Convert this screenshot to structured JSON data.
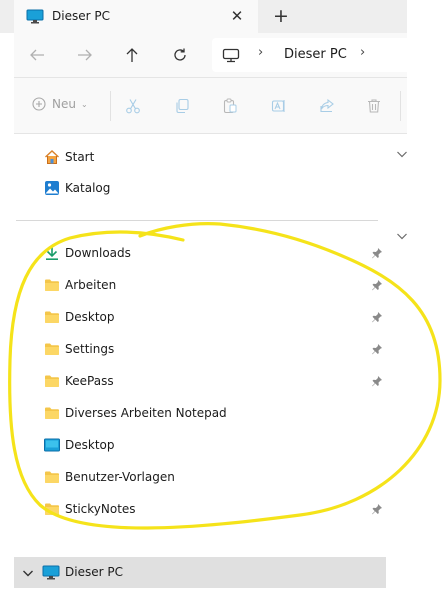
{
  "window": {
    "tab_title": "Dieser PC",
    "close_glyph": "✕",
    "new_tab_glyph": "+"
  },
  "address": {
    "crumbs": [
      "Dieser PC"
    ],
    "separator": "›"
  },
  "toolbar": {
    "new_label": "Neu",
    "new_chevron": "⌄"
  },
  "nav": {
    "top_items": [
      {
        "label": "Start",
        "icon": "home-icon"
      },
      {
        "label": "Katalog",
        "icon": "gallery-icon"
      }
    ],
    "quick_access": [
      {
        "label": "Downloads",
        "icon": "download-icon",
        "pinned": true
      },
      {
        "label": "Arbeiten",
        "icon": "folder-icon",
        "pinned": true
      },
      {
        "label": "Desktop",
        "icon": "folder-icon",
        "pinned": true
      },
      {
        "label": "Settings",
        "icon": "folder-icon",
        "pinned": true
      },
      {
        "label": "KeePass",
        "icon": "folder-icon",
        "pinned": true
      },
      {
        "label": "Diverses Arbeiten Notepad",
        "icon": "folder-icon",
        "pinned": false
      },
      {
        "label": "Desktop",
        "icon": "desktop-icon",
        "pinned": false
      },
      {
        "label": "Benutzer-Vorlagen",
        "icon": "folder-icon",
        "pinned": false
      },
      {
        "label": "StickyNotes",
        "icon": "folder-icon",
        "pinned": true
      }
    ],
    "this_pc": {
      "label": "Dieser PC",
      "icon": "computer-icon",
      "selected": true
    }
  },
  "colors": {
    "annotation": "#f5e31a",
    "folder": "#f4c64a",
    "accent": "#0078d4",
    "download": "#1a9c6a",
    "selected_row": "#e0e0e0"
  }
}
